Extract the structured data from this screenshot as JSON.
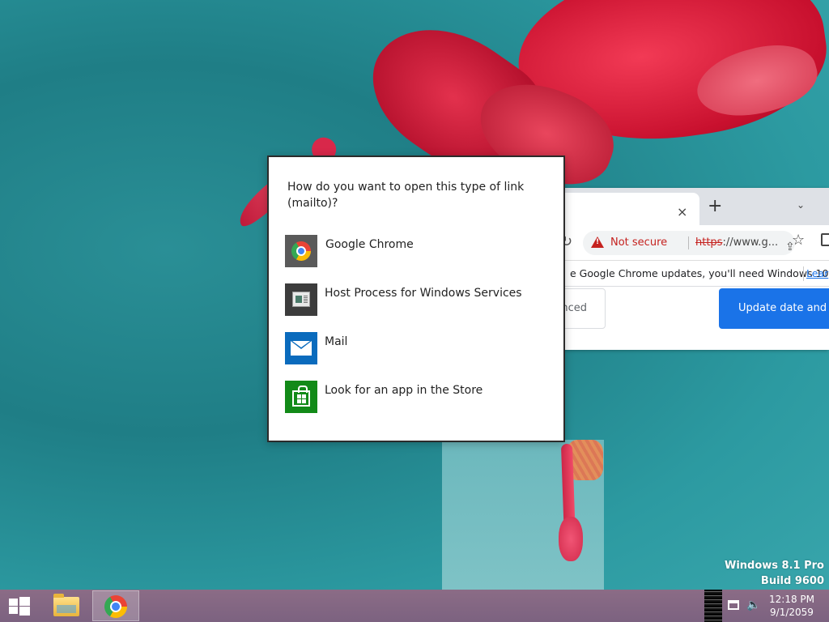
{
  "desktop": {
    "watermark_line1": "Windows 8.1 Pro",
    "watermark_line2": "Build 9600"
  },
  "browser": {
    "new_tab_glyph": "+",
    "close_tab_glyph": "×",
    "tab_list_glyph": "⌄",
    "not_secure_label": "Not secure",
    "url_scheme": "https",
    "url_rest": "://www.g...",
    "infobar_text": "e Google Chrome updates, you'll need Windows 10...",
    "infobar_link": "Lear",
    "advanced_button": "nced",
    "update_button": "Update date and t"
  },
  "dialog": {
    "title": "How do you want to open this type of link (mailto)?",
    "apps": [
      {
        "label": "Google Chrome",
        "icon": "chrome-icon"
      },
      {
        "label": "Host Process for Windows Services",
        "icon": "host-process-icon"
      },
      {
        "label": "Mail",
        "icon": "mail-icon"
      },
      {
        "label": "Look for an app in the Store",
        "icon": "store-icon"
      }
    ]
  },
  "taskbar": {
    "clock_time": "12:18 PM",
    "clock_date": "9/1/2059"
  },
  "colors": {
    "chrome_blue": "#1a73e8",
    "not_secure_red": "#c5221f",
    "mail_tile": "#0a6bbd",
    "store_tile": "#128a18",
    "taskbar": "#7c6280"
  }
}
